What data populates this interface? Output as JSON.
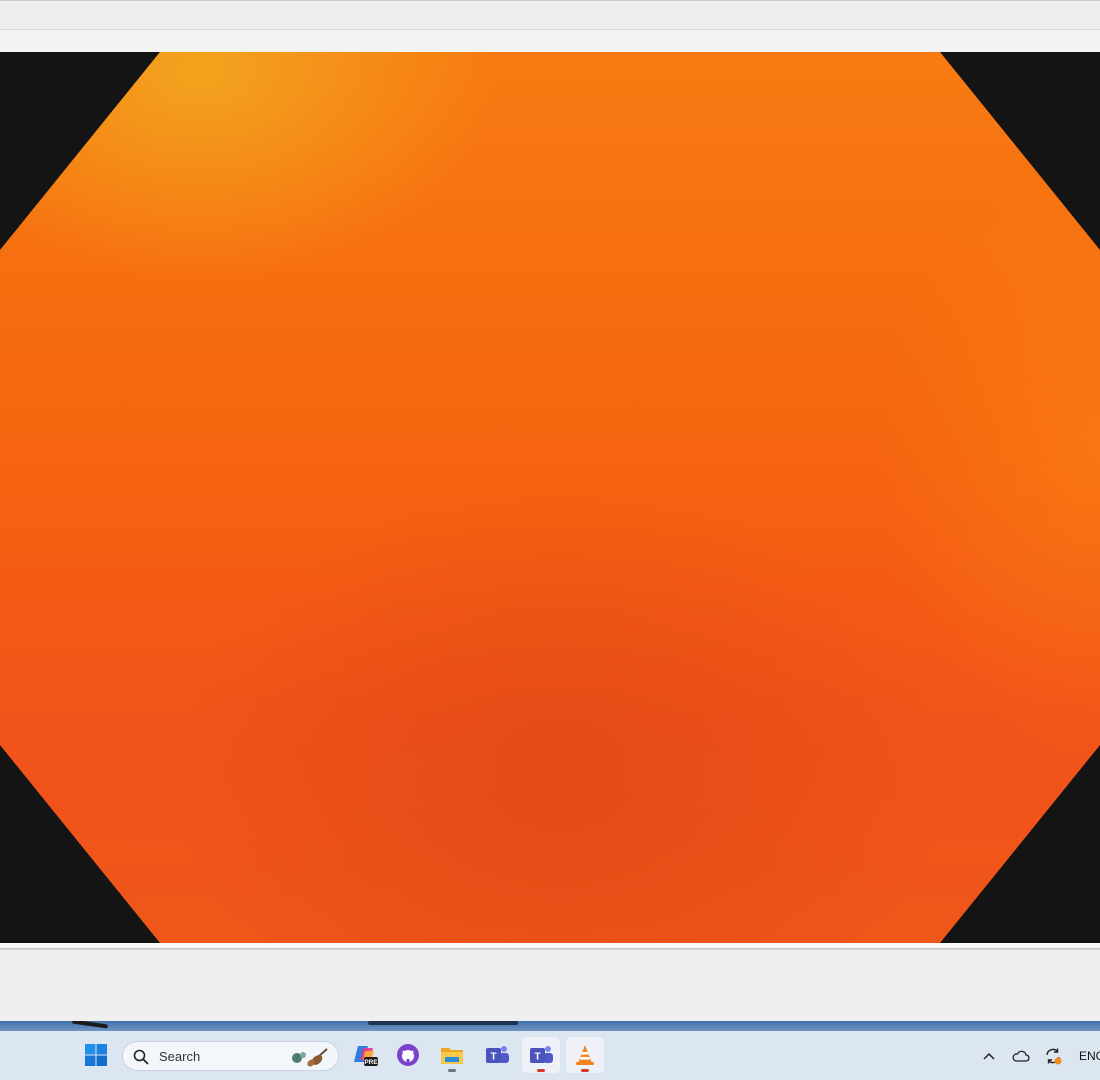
{
  "player": {
    "video": {
      "frame_colors": [
        "#f77b12",
        "#f2531a",
        "#141414"
      ]
    }
  },
  "taskbar": {
    "search": {
      "placeholder": "Search"
    },
    "apps": [
      {
        "name": "windows-start",
        "icon": "windows-logo-icon"
      },
      {
        "name": "copilot",
        "icon": "copilot-pre-icon"
      },
      {
        "name": "github-desktop",
        "icon": "github-icon"
      },
      {
        "name": "file-explorer",
        "icon": "folder-icon"
      },
      {
        "name": "teams-classic",
        "icon": "teams-icon"
      },
      {
        "name": "teams",
        "icon": "teams-icon"
      },
      {
        "name": "vlc",
        "icon": "vlc-cone-icon"
      }
    ],
    "tray": {
      "icons": [
        "chevron-up-icon",
        "onedrive-cloud-icon",
        "sync-icon"
      ],
      "language": "ENG"
    }
  }
}
